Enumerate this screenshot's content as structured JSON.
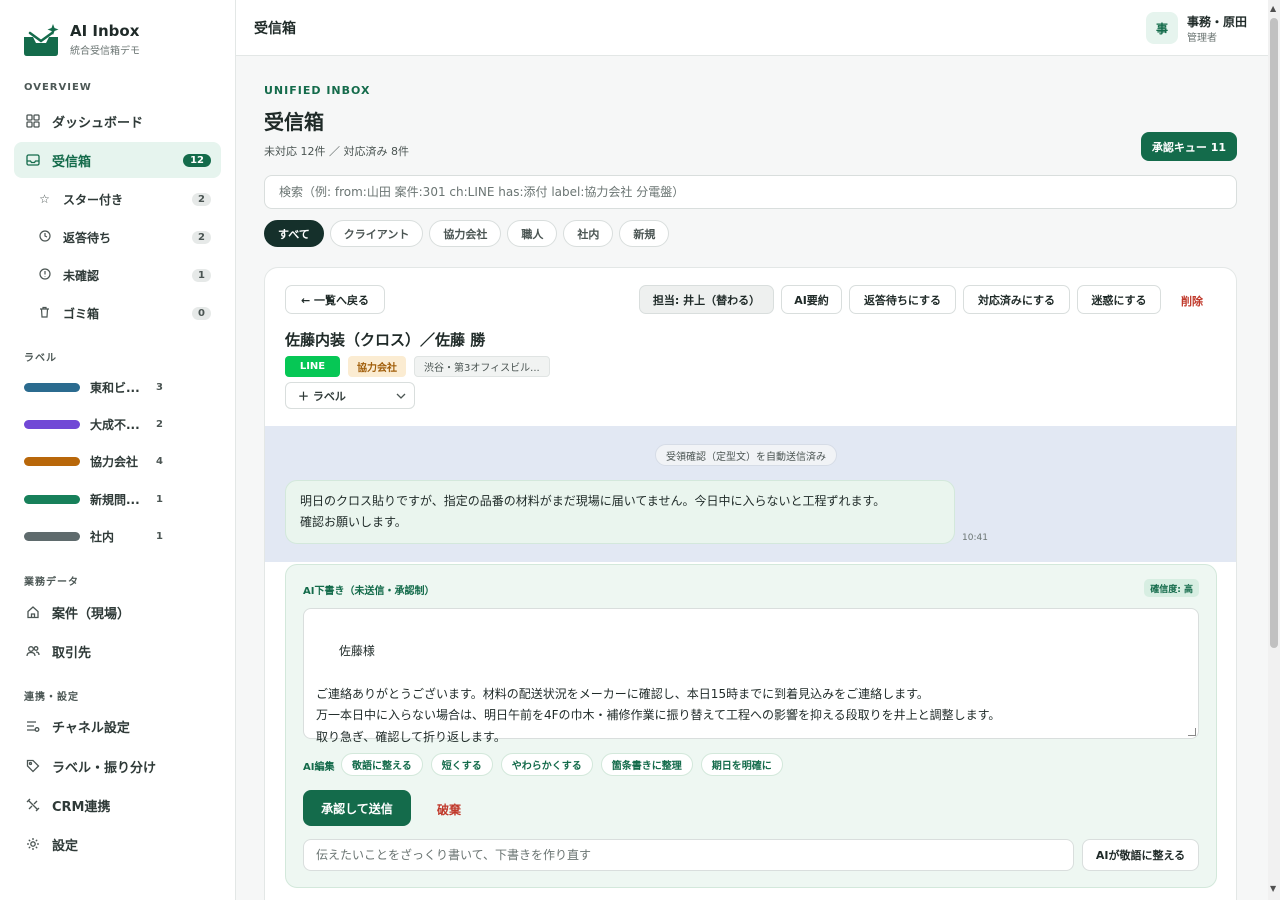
{
  "brand": {
    "name": "AI Inbox",
    "subtitle": "統合受信箱デモ"
  },
  "sidebar": {
    "sections": {
      "overview": "OVERVIEW",
      "labels": "ラベル",
      "business": "業務データ",
      "integration": "連携・設定"
    },
    "nav": [
      {
        "label": "ダッシュボード",
        "icon": "grid-icon"
      },
      {
        "label": "受信箱",
        "icon": "inbox-icon",
        "count": "12",
        "active": true
      }
    ],
    "sub": [
      {
        "label": "スター付き",
        "icon": "star-icon",
        "count": "2"
      },
      {
        "label": "返答待ち",
        "icon": "clock-icon",
        "count": "2"
      },
      {
        "label": "未確認",
        "icon": "alert-circle-icon",
        "count": "1"
      },
      {
        "label": "ゴミ箱",
        "icon": "trash-icon",
        "count": "0"
      }
    ],
    "labels": [
      {
        "name": "東和ビ...",
        "count": "3",
        "color": "#2b6b8f"
      },
      {
        "name": "大成不...",
        "count": "2",
        "color": "#7148d6"
      },
      {
        "name": "協力会社",
        "count": "4",
        "color": "#b8670a"
      },
      {
        "name": "新規問...",
        "count": "1",
        "color": "#17805a"
      },
      {
        "name": "社内",
        "count": "1",
        "color": "#5f6b6d"
      }
    ],
    "business": [
      {
        "label": "案件（現場）",
        "icon": "home-icon"
      },
      {
        "label": "取引先",
        "icon": "users-icon"
      }
    ],
    "integration": [
      {
        "label": "チャネル設定",
        "icon": "sliders-icon"
      },
      {
        "label": "ラベル・振り分け",
        "icon": "tag-icon"
      },
      {
        "label": "CRM連携",
        "icon": "link-icon"
      },
      {
        "label": "設定",
        "icon": "gear-icon"
      }
    ]
  },
  "topbar": {
    "title": "受信箱",
    "avatar_initial": "事",
    "user_name": "事務・原田",
    "user_role": "管理者"
  },
  "main": {
    "eyebrow": "UNIFIED INBOX",
    "title": "受信箱",
    "subtitle": "未対応 12件 ／ 対応済み 8件",
    "approval_queue": "承認キュー 11",
    "search_placeholder": "検索（例: from:山田 案件:301 ch:LINE has:添付 label:協力会社 分電盤）",
    "filters": [
      "すべて",
      "クライアント",
      "協力会社",
      "職人",
      "社内",
      "新規"
    ],
    "active_filter": "すべて"
  },
  "thread": {
    "back": "← 一覧へ戻る",
    "assignee": "担当: 井上（替わる）",
    "ai_summary": "AI要約",
    "await_reply": "返答待ちにする",
    "mark_done": "対応済みにする",
    "spam": "迷惑にする",
    "delete": "削除",
    "title": "佐藤内装（クロス）／佐藤 勝",
    "tags": {
      "channel": "LINE",
      "category": "協力会社",
      "location": "渋谷・第3オフィスビル..."
    },
    "label_select": "＋ ラベル",
    "system_msg": "受領確認（定型文）を自動送信済み",
    "message_line1": "明日のクロス貼りですが、指定の品番の材料がまだ現場に届いてません。今日中に入らないと工程ずれます。",
    "message_line2": "確認お願いします。",
    "time": "10:41"
  },
  "draft": {
    "header": "AI下書き（未送信・承認制）",
    "confidence": "確信度: 高",
    "body": "佐藤様\n\nご連絡ありがとうございます。材料の配送状況をメーカーに確認し、本日15時までに到着見込みをご連絡します。\n万一本日中に入らない場合は、明日午前を4Fの巾木・補修作業に振り替えて工程への影響を抑える段取りを井上と調整します。\n取り急ぎ、確認して折り返します。",
    "edit_label": "AI編集",
    "edits": [
      "敬語に整える",
      "短くする",
      "やわらかくする",
      "箇条書きに整理",
      "期日を明確に"
    ],
    "send": "承認して送信",
    "discard": "破棄",
    "rough_placeholder": "伝えたいことをざっくり書いて、下書きを作り直す",
    "polish": "AIが敬語に整える"
  }
}
